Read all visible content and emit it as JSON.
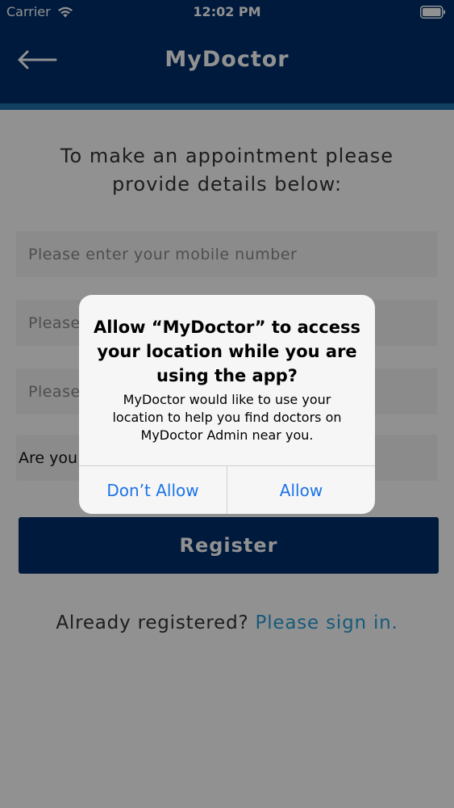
{
  "status_bar": {
    "carrier": "Carrier",
    "time": "12:02 PM"
  },
  "nav": {
    "title": "MyDoctor"
  },
  "form": {
    "intro": "To make an appointment please\nprovide details below:",
    "mobile_placeholder": "Please enter your mobile number",
    "field2_placeholder": "Please",
    "field3_placeholder": "Please",
    "question_label": "Are you",
    "register_label": "Register"
  },
  "signin": {
    "prefix": "Already registered?",
    "link": "Please sign in."
  },
  "alert": {
    "title": "Allow “MyDoctor” to access\nyour location while you are\nusing the app?",
    "message": "MyDoctor would like to use your\nlocation to help you find doctors on\nMyDoctor Admin near you.",
    "deny_label": "Don’t Allow",
    "allow_label": "Allow"
  },
  "colors": {
    "primary": "#002f6c",
    "accent": "#1f6fa8",
    "link": "#2a9fd6",
    "alert_action": "#1a73e8"
  }
}
